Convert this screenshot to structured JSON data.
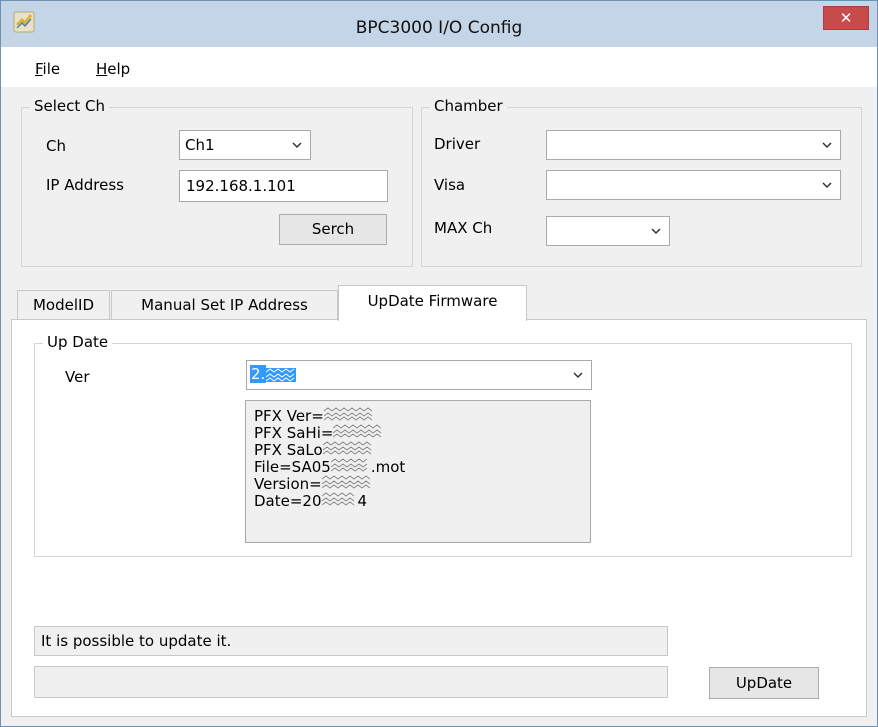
{
  "window": {
    "title": "BPC3000 I/O Config",
    "close_symbol": "✕"
  },
  "menu": {
    "file": {
      "mnemonic": "F",
      "rest": "ile"
    },
    "help": {
      "mnemonic": "H",
      "rest": "elp"
    }
  },
  "select_ch": {
    "legend": "Select Ch",
    "ch_label": "Ch",
    "ch_value": "Ch1",
    "ip_label": "IP Address",
    "ip_value": "192.168.1.101",
    "search_button": "Serch"
  },
  "chamber": {
    "legend": "Chamber",
    "driver_label": "Driver",
    "driver_value": "",
    "visa_label": "Visa",
    "visa_value": "",
    "maxch_label": "MAX Ch",
    "maxch_value": ""
  },
  "tabs": [
    {
      "label": "ModelID"
    },
    {
      "label": "Manual Set IP Address"
    },
    {
      "label": "UpDate Firmware"
    }
  ],
  "update": {
    "legend": "Up Date",
    "ver_label": "Ver",
    "ver_value": "2.",
    "info_lines": [
      "PFX Ver=",
      "PFX SaHi=",
      "PFX SaLo",
      "File=SA05",
      ".mot",
      "Version=",
      "Date=20",
      "4"
    ],
    "status_text": "It is possible to update it.",
    "progress_text": "",
    "progress": 0,
    "update_button": "UpDate"
  },
  "colors": {
    "titlebar": "#c5d5e8",
    "close": "#c74b4b",
    "selection": "#3399ff"
  }
}
